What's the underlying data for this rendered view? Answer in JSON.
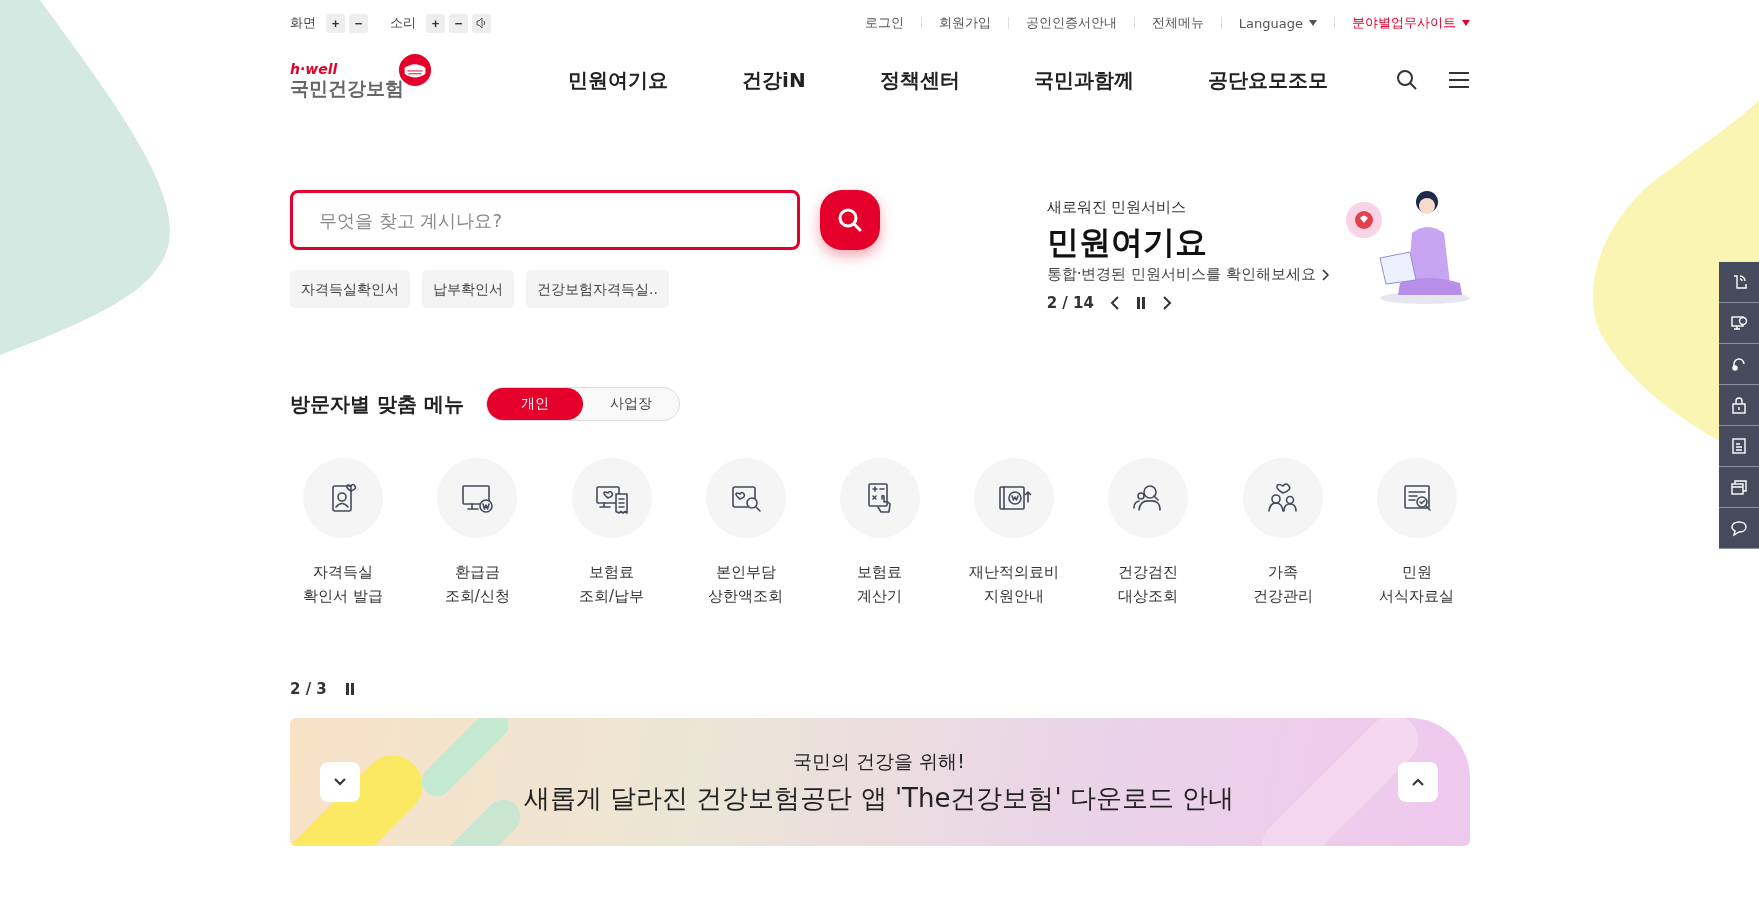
{
  "utility_bar": {
    "groups": [
      {
        "label": "화면",
        "buttons": [
          "+",
          "−"
        ],
        "kind": "screen"
      },
      {
        "label": "소리",
        "buttons": [
          "+",
          "−"
        ],
        "kind": "sound"
      }
    ],
    "links": [
      {
        "label": "로그인",
        "kind": "link"
      },
      {
        "label": "회원가입",
        "kind": "link"
      },
      {
        "label": "공인인증서안내",
        "kind": "link"
      },
      {
        "label": "전체메뉴",
        "kind": "link"
      },
      {
        "label": "Language",
        "kind": "dropdown"
      },
      {
        "label": "분야별업무사이트",
        "kind": "highlight"
      }
    ]
  },
  "logo": {
    "tagline": "h·well",
    "name": "국민건강보험"
  },
  "nav": [
    "민원여기요",
    "건강iN",
    "정책센터",
    "국민과함께",
    "공단요모조모"
  ],
  "search": {
    "placeholder": "무엇을 찾고 계시나요?",
    "chips": [
      "자격득실확인서",
      "납부확인서",
      "건강보험자격득실.."
    ]
  },
  "notice": {
    "eyebrow": "새로워진 민원서비스",
    "title": "민원여기요",
    "description": "통합·변경된 민원서비스를 확인해보세요",
    "counter": "2 / 14"
  },
  "visitor_menu": {
    "title": "방문자별 맞춤 메뉴",
    "tabs": [
      {
        "label": "개인",
        "selected": true
      },
      {
        "label": "사업장",
        "selected": false
      }
    ],
    "items": [
      {
        "lines": [
          "자격득실",
          "확인서 발급"
        ]
      },
      {
        "lines": [
          "환급금",
          "조회/신청"
        ]
      },
      {
        "lines": [
          "보험료",
          "조회/납부"
        ]
      },
      {
        "lines": [
          "본인부담",
          "상한액조회"
        ]
      },
      {
        "lines": [
          "보험료",
          "계산기"
        ]
      },
      {
        "lines": [
          "재난적의료비",
          "지원안내"
        ]
      },
      {
        "lines": [
          "건강검진",
          "대상조회"
        ]
      },
      {
        "lines": [
          "가족",
          "건강관리"
        ]
      },
      {
        "lines": [
          "민원",
          "서식자료실"
        ]
      }
    ]
  },
  "banner": {
    "counter": "2 / 3",
    "eyebrow": "국민의 건강을 위해!",
    "title": "새롭게 달라진 건강보험공단 앱 'The건강보험' 다운로드 안내"
  }
}
